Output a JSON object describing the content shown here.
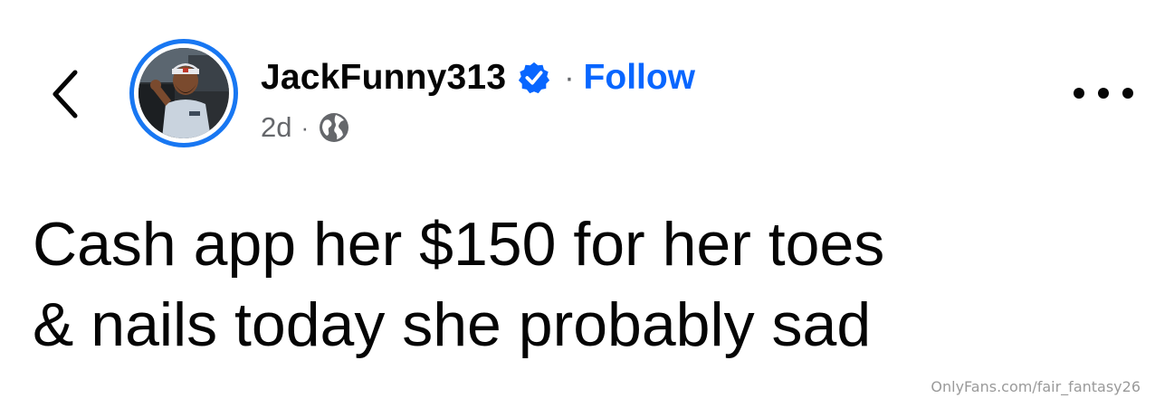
{
  "post": {
    "author": {
      "username": "JackFunny313",
      "verified": true,
      "follow_label": "Follow",
      "separator": "·"
    },
    "meta": {
      "time": "2d",
      "separator": "·",
      "audience_icon": "globe-icon"
    },
    "text_line1": "Cash app her $150 for her toes",
    "text_line2": "& nails today she probably sad"
  },
  "watermark": "OnlyFans.com/fair_fantasy26",
  "icons": {
    "back": "chevron-left-icon",
    "verified": "verified-badge-icon",
    "more": "more-options-icon"
  },
  "colors": {
    "accent": "#1877f2",
    "follow": "#0866ff",
    "secondary_text": "#65676b",
    "primary_text": "#050505"
  }
}
